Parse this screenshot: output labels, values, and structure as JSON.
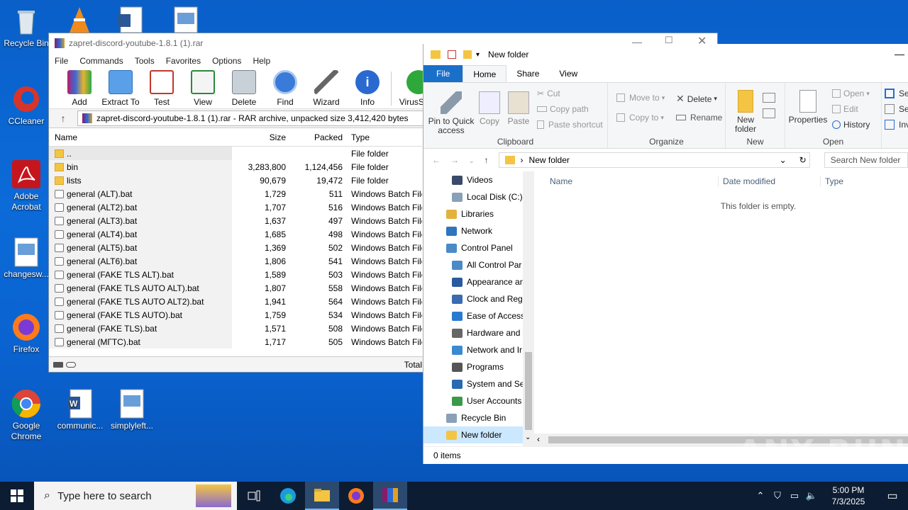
{
  "desktop": {
    "icons": [
      {
        "label": "Recycle Bin"
      },
      {
        "label": "CCleaner"
      },
      {
        "label": "Adobe Acrobat"
      },
      {
        "label": "changesw..."
      },
      {
        "label": "Firefox"
      },
      {
        "label": "Google Chrome"
      },
      {
        "label": "communic..."
      },
      {
        "label": "simplyleft..."
      }
    ]
  },
  "winrar": {
    "title": "zapret-discord-youtube-1.8.1 (1).rar",
    "menu": [
      "File",
      "Commands",
      "Tools",
      "Favorites",
      "Options",
      "Help"
    ],
    "toolbar": [
      "Add",
      "Extract To",
      "Test",
      "View",
      "Delete",
      "Find",
      "Wizard",
      "Info",
      "VirusScan"
    ],
    "path": "zapret-discord-youtube-1.8.1 (1).rar - RAR archive, unpacked size 3,412,420 bytes",
    "columns": {
      "name": "Name",
      "size": "Size",
      "packed": "Packed",
      "type": "Type"
    },
    "rows": [
      {
        "name": "..",
        "size": "",
        "packed": "",
        "type": "File folder",
        "kind": "folder"
      },
      {
        "name": "bin",
        "size": "3,283,800",
        "packed": "1,124,456",
        "type": "File folder",
        "kind": "folder"
      },
      {
        "name": "lists",
        "size": "90,679",
        "packed": "19,472",
        "type": "File folder",
        "kind": "folder"
      },
      {
        "name": "general (ALT).bat",
        "size": "1,729",
        "packed": "511",
        "type": "Windows Batch File",
        "kind": "bat"
      },
      {
        "name": "general (ALT2).bat",
        "size": "1,707",
        "packed": "516",
        "type": "Windows Batch File",
        "kind": "bat"
      },
      {
        "name": "general (ALT3).bat",
        "size": "1,637",
        "packed": "497",
        "type": "Windows Batch File",
        "kind": "bat"
      },
      {
        "name": "general (ALT4).bat",
        "size": "1,685",
        "packed": "498",
        "type": "Windows Batch File",
        "kind": "bat"
      },
      {
        "name": "general (ALT5).bat",
        "size": "1,369",
        "packed": "502",
        "type": "Windows Batch File",
        "kind": "bat"
      },
      {
        "name": "general (ALT6).bat",
        "size": "1,806",
        "packed": "541",
        "type": "Windows Batch File",
        "kind": "bat"
      },
      {
        "name": "general (FAKE TLS ALT).bat",
        "size": "1,589",
        "packed": "503",
        "type": "Windows Batch File",
        "kind": "bat"
      },
      {
        "name": "general (FAKE TLS AUTO ALT).bat",
        "size": "1,807",
        "packed": "558",
        "type": "Windows Batch File",
        "kind": "bat"
      },
      {
        "name": "general (FAKE TLS AUTO ALT2).bat",
        "size": "1,941",
        "packed": "564",
        "type": "Windows Batch File",
        "kind": "bat"
      },
      {
        "name": "general (FAKE TLS AUTO).bat",
        "size": "1,759",
        "packed": "534",
        "type": "Windows Batch File",
        "kind": "bat"
      },
      {
        "name": "general (FAKE TLS).bat",
        "size": "1,571",
        "packed": "508",
        "type": "Windows Batch File",
        "kind": "bat"
      },
      {
        "name": "general (МГТС).bat",
        "size": "1,717",
        "packed": "505",
        "type": "Windows Batch File",
        "kind": "bat"
      }
    ],
    "status_total": "Total"
  },
  "explorer": {
    "title": "New folder",
    "tabs": [
      "File",
      "Home",
      "Share",
      "View"
    ],
    "clipboard": {
      "pin": "Pin to Quick access",
      "copy": "Copy",
      "paste": "Paste",
      "cut": "Cut",
      "copy_path": "Copy path",
      "paste_shortcut": "Paste shortcut",
      "label": "Clipboard"
    },
    "organize": {
      "move_to": "Move to",
      "copy_to": "Copy to",
      "delete": "Delete",
      "rename": "Rename",
      "label": "Organize"
    },
    "new": {
      "new_folder": "New folder",
      "label": "New"
    },
    "open": {
      "properties": "Properties",
      "open": "Open",
      "edit": "Edit",
      "history": "History",
      "label": "Open"
    },
    "select": {
      "sel1": "Sel",
      "sel2": "Sel",
      "inv": "Inv"
    },
    "breadcrumb": "New folder",
    "search_placeholder": "Search New folder",
    "nav": [
      {
        "label": "Videos",
        "indent": 1,
        "color": "#3a4a6a"
      },
      {
        "label": "Local Disk (C:)",
        "indent": 1,
        "color": "#8aa0b8"
      },
      {
        "label": "Libraries",
        "indent": 0,
        "color": "#e2b23c"
      },
      {
        "label": "Network",
        "indent": 0,
        "color": "#2f74c0"
      },
      {
        "label": "Control Panel",
        "indent": 0,
        "color": "#4a8ac8"
      },
      {
        "label": "All Control Par",
        "indent": 1,
        "color": "#4a8ac8"
      },
      {
        "label": "Appearance an",
        "indent": 1,
        "color": "#2a5aa0"
      },
      {
        "label": "Clock and Regi",
        "indent": 1,
        "color": "#3a6ab0"
      },
      {
        "label": "Ease of Access",
        "indent": 1,
        "color": "#2a7ad0"
      },
      {
        "label": "Hardware and",
        "indent": 1,
        "color": "#666666"
      },
      {
        "label": "Network and Ir",
        "indent": 1,
        "color": "#3a8ad0"
      },
      {
        "label": "Programs",
        "indent": 1,
        "color": "#555555"
      },
      {
        "label": "System and Sec",
        "indent": 1,
        "color": "#2a6ab0"
      },
      {
        "label": "User Accounts",
        "indent": 1,
        "color": "#3a9a4a"
      },
      {
        "label": "Recycle Bin",
        "indent": 0,
        "color": "#8aa0b8"
      },
      {
        "label": "New folder",
        "indent": 0,
        "color": "#f4c542",
        "selected": true
      }
    ],
    "columns": {
      "name": "Name",
      "date": "Date modified",
      "type": "Type"
    },
    "empty_message": "This folder is empty.",
    "status": "0 items"
  },
  "taskbar": {
    "search_placeholder": "Type here to search",
    "time": "5:00 PM",
    "date": "7/3/2025"
  },
  "watermark": "ANY RUN"
}
